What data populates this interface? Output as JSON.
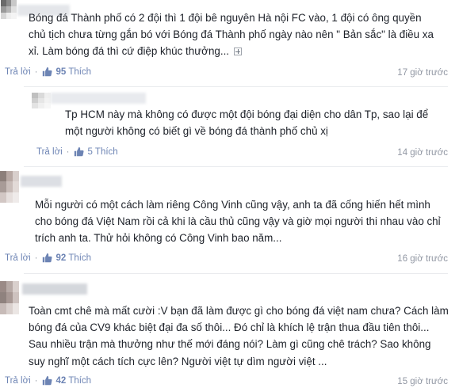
{
  "reply_label": "Trả lời",
  "like_label": "Thích",
  "separator": "·",
  "comments": [
    {
      "text": "Bóng đá Thành phố có 2 đội thì 1 đội bê nguyên Hà nội FC vào, 1 đội có ông quyền chủ tịch chưa từng gắn bó với Bóng đá Thành phố ngày nào nên \" Bản sắc\" là điều xa xỉ. Làm bóng đá thì cứ điệp khúc thưởng...",
      "likes": "95",
      "time": "17 giờ trước"
    },
    {
      "text": "Tp HCM này mà không có được một đội bóng đại diện cho dân Tp, sao lại để một người không có biết gì về bóng đá thành phố chủ xị",
      "likes": "5",
      "time": "14 giờ trước"
    },
    {
      "text": "Mỗi người có một cách làm riêng Công Vinh cũng vậy, anh ta đã cống hiến hết mình cho bóng đá Việt Nam rồi cả khi là cầu thủ cũng vậy và giờ mọi người thi nhau vào chỉ trích anh ta. Thử hỏi không có Công Vinh bao năm...",
      "likes": "92",
      "time": "16 giờ trước"
    },
    {
      "text": "Toàn cmt chê mà mất cười :V bạn đã làm được gì cho bóng đá việt nam chưa? Cách làm bóng đá của CV9 khác biệt đại đa số thôi... Đó chỉ là khích lệ trận thua đầu tiên thôi... Sau nhiều trận mà thưởng như thế mới đáng nói? Làm gì cũng chê trách? Sao không suy nghĩ một cách tích cực lên? Người việt tự dìm người việt ...",
      "likes": "42",
      "time": "15 giờ trước"
    }
  ],
  "colors": {
    "link": "#6d84b4",
    "meta": "#9197a3",
    "text": "#1d2129",
    "divider": "#e9ebee"
  },
  "icons": [
    "like-thumb-icon",
    "expand-plus-icon"
  ]
}
